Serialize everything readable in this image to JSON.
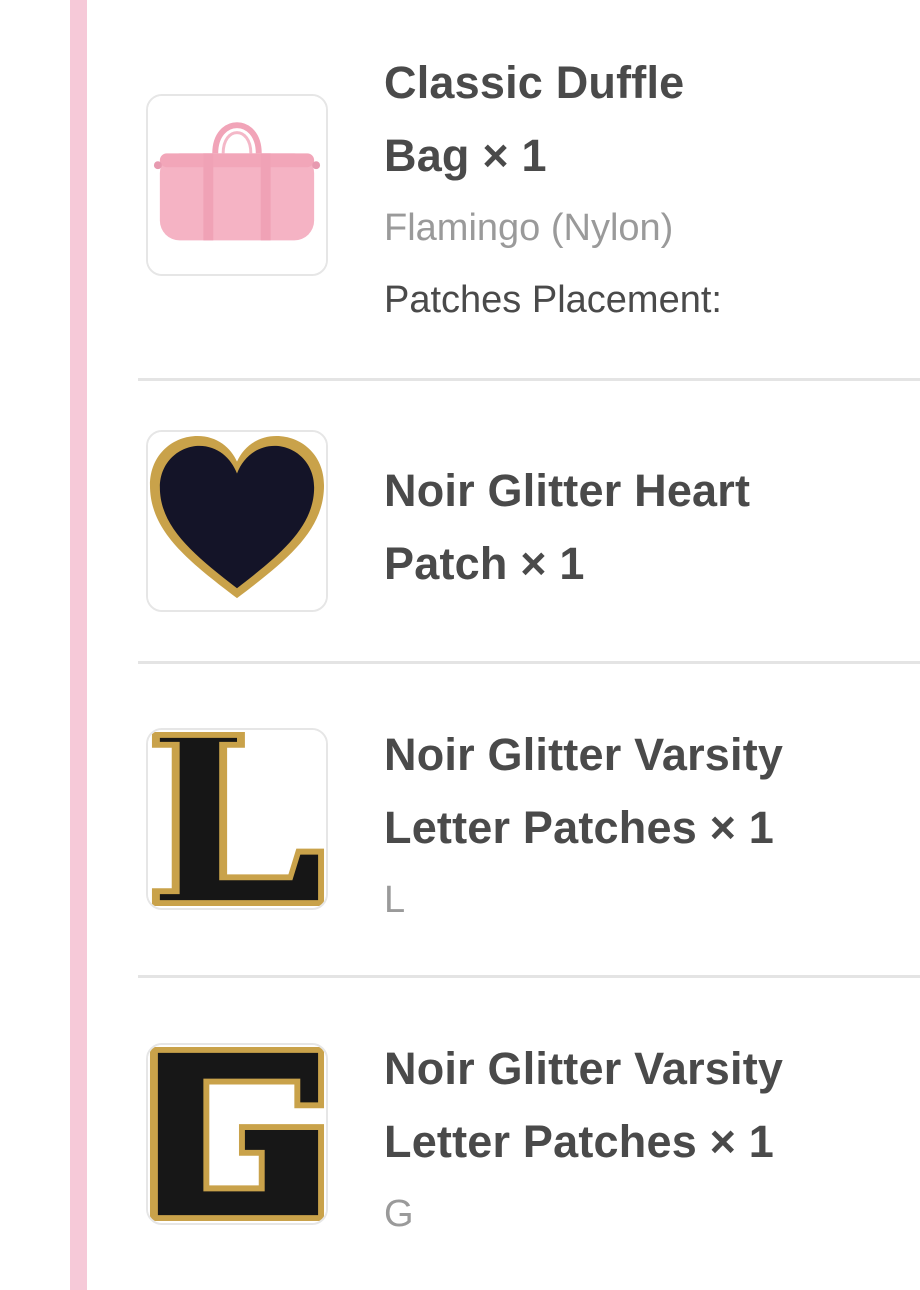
{
  "accent_color": "#f6c9d8",
  "items": [
    {
      "icon": "pink-duffle-bag-image",
      "title_line1": "Classic Duffle",
      "title_line2": "Bag × 1",
      "variant": "Flamingo (Nylon)",
      "meta": "Patches Placement:"
    },
    {
      "icon": "black-glitter-heart-patch-image",
      "title_line1": "Noir Glitter Heart",
      "title_line2": "Patch × 1"
    },
    {
      "icon": "letter-l-patch-image",
      "title_line1": "Noir Glitter Varsity",
      "title_line2": "Letter Patches × 1",
      "variant": "L"
    },
    {
      "icon": "letter-g-patch-image",
      "title_line1": "Noir Glitter Varsity",
      "title_line2": "Letter Patches × 1",
      "variant": "G"
    }
  ]
}
